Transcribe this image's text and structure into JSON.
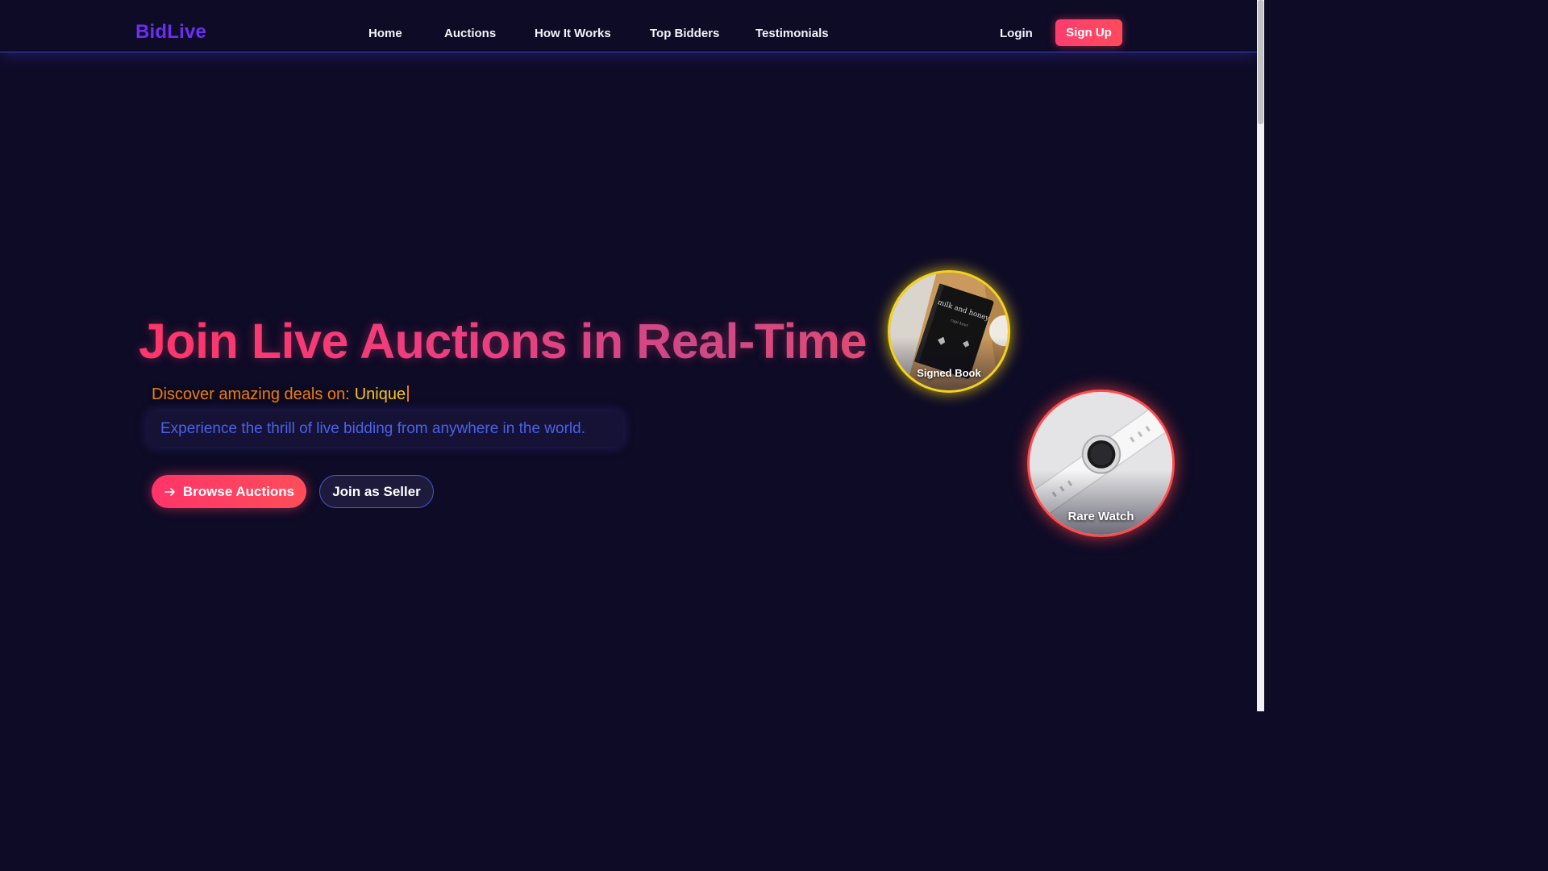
{
  "navbar": {
    "brand": "BidLive",
    "links": [
      {
        "label": "Home"
      },
      {
        "label": "Auctions"
      },
      {
        "label": "How It Works"
      },
      {
        "label": "Top Bidders"
      },
      {
        "label": "Testimonials"
      }
    ],
    "login_label": "Login",
    "signup_label": "Sign Up"
  },
  "hero": {
    "title": "Join Live Auctions in Real-Time",
    "discover_prefix": "Discover amazing deals on:",
    "discover_word": "Unique",
    "subtitle": "Experience the thrill of live bidding from anywhere in the world.",
    "browse_label": "Browse Auctions",
    "browse_icon": "arrow-right-icon",
    "seller_label": "Join as Seller"
  },
  "items": [
    {
      "label": "Signed Book",
      "book_title": "milk and honey",
      "book_author": "rupi kaur",
      "border_color": "#f3d31a"
    },
    {
      "label": "Rare Watch",
      "border_color": "#ff4d4d"
    }
  ],
  "colors": {
    "background": "#0e0b26",
    "brand": "#6b2ff2",
    "accent": "#ff3d6e",
    "nav_border": "#3b3fc4",
    "discover_prefix": "#e87a1f",
    "discover_word": "#f5c518",
    "subtitle": "#4a61e8"
  }
}
